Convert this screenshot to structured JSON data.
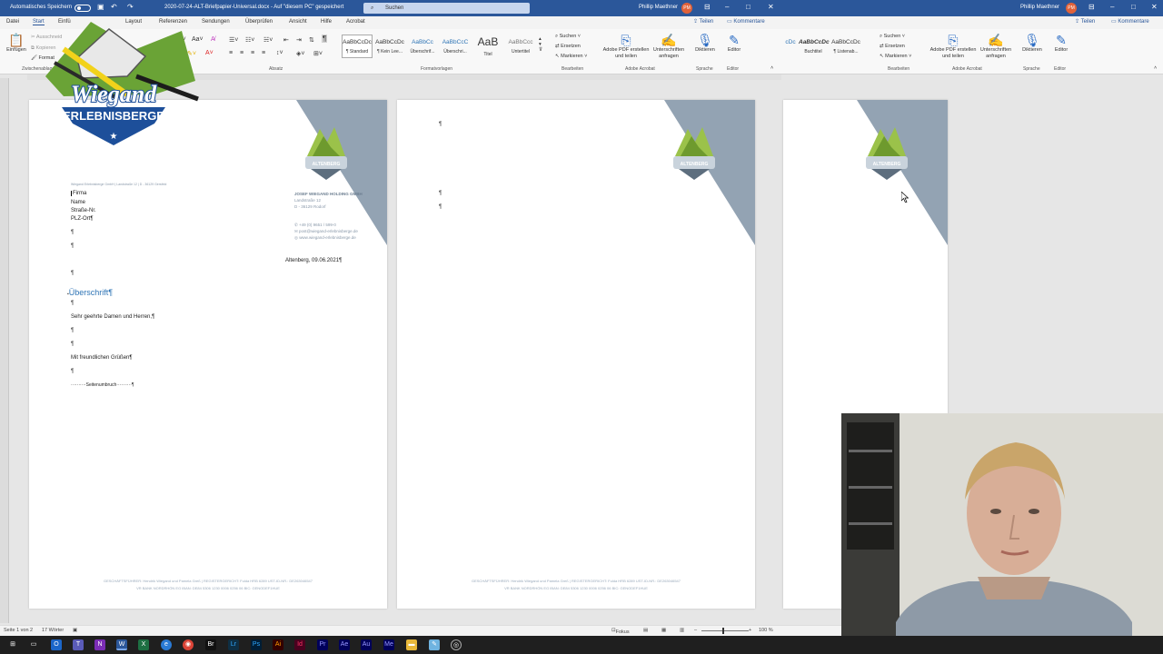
{
  "titlebar": {
    "autosave_label": "Automatisches Speichern",
    "doc_title": "2020-07-24-ALT-Briefpapier-Universal.docx  -  Auf \"diesem PC\" gespeichert",
    "search_placeholder": "Suchen",
    "user_name": "Phillip Maethner",
    "user_initials": "PM"
  },
  "menu": {
    "items": [
      "Datei",
      "Start",
      "Einfü",
      "Layout",
      "Referenzen",
      "Sendungen",
      "Überprüfen",
      "Ansicht",
      "Hilfe",
      "Acrobat"
    ],
    "share": "Teilen",
    "comments": "Kommentare"
  },
  "ribbon": {
    "paste": "Einfügen",
    "cut": "Ausschneid",
    "copy": "Kopieren",
    "format": "Format",
    "clipboard_label": "Zwischenablage",
    "paragraph_label": "Absatz",
    "styles_label": "Formatvorlagen",
    "edit_label": "Bearbeiten",
    "acrobat_label": "Adobe Acrobat",
    "speech_label": "Sprache",
    "editor_label": "Editor",
    "styles": [
      {
        "sample": "AaBbCcDc",
        "name": "¶ Standard"
      },
      {
        "sample": "AaBbCcDc",
        "name": "¶ Kein Lee..."
      },
      {
        "sample": "AaBbCc",
        "name": "Überschrif..."
      },
      {
        "sample": "AaBbCcC",
        "name": "Überschri..."
      },
      {
        "sample": "AaB",
        "name": "Titel"
      },
      {
        "sample": "AaBbCcc",
        "name": "Untertitel"
      }
    ],
    "find": "Suchen",
    "replace": "Ersetzen",
    "select": "Markieren",
    "pdf_btn": "Adobe PDF erstellen und teilen",
    "sign_btn": "Unterschriften anfragen",
    "dictate_btn": "Diktieren",
    "editor_btn": "Editor"
  },
  "ribbon2": {
    "styles": [
      {
        "sample": "AaBbCcDc",
        "name": "Buchtitel"
      },
      {
        "sample": "AaBbCcDc",
        "name": "¶ Listenab..."
      }
    ]
  },
  "page1": {
    "sender_line": "Wiegand Erlebnisberge GmbH | Landstraße 12 | D - 36129 Gersfeld",
    "recipient": [
      "Firma",
      "Name",
      "Straße-Nr.",
      "PLZ-Ort¶"
    ],
    "company": "JOSEF WIEGAND HOLDING GMBH",
    "address1": "Landstraße 12",
    "address2": "D - 36129 Rodorf",
    "phone": "+49 (0) 9651 / 599-0",
    "email": "post@wiegand-erlebnisberge.de",
    "web": "www.wiegand-erlebnisberge.de",
    "date": "Altenberg, 09.06.2021¶",
    "heading": "Überschrift¶",
    "salutation": "Sehr geehrte Damen und Herren,¶",
    "closing": "Mit freundlichen Grüßen¶",
    "pagebreak": "··········Seitenumbruch··········¶",
    "pilcrow": "¶",
    "footer1": "GESCHÄFTSFÜHRER: Hendrik Wiegand und Pamela Greß | REGISTERGERICHT: Fulda HRB 6289 UST-ID-NR.: DE263046547",
    "footer2": "VR BANK NORDRHÖN EG IBAN: DE84 5306 1230 0006 0256 06 BIC: GENODEF1HUE"
  },
  "logo": {
    "brand_top": "Wiegand",
    "brand_bottom": "ERLEBNISBERGE",
    "badge": "ALTENBERG"
  },
  "statusbar": {
    "page": "Seite 1 von 2",
    "words": "17 Wörter",
    "focus": "Fokus",
    "zoom": "100 %"
  }
}
